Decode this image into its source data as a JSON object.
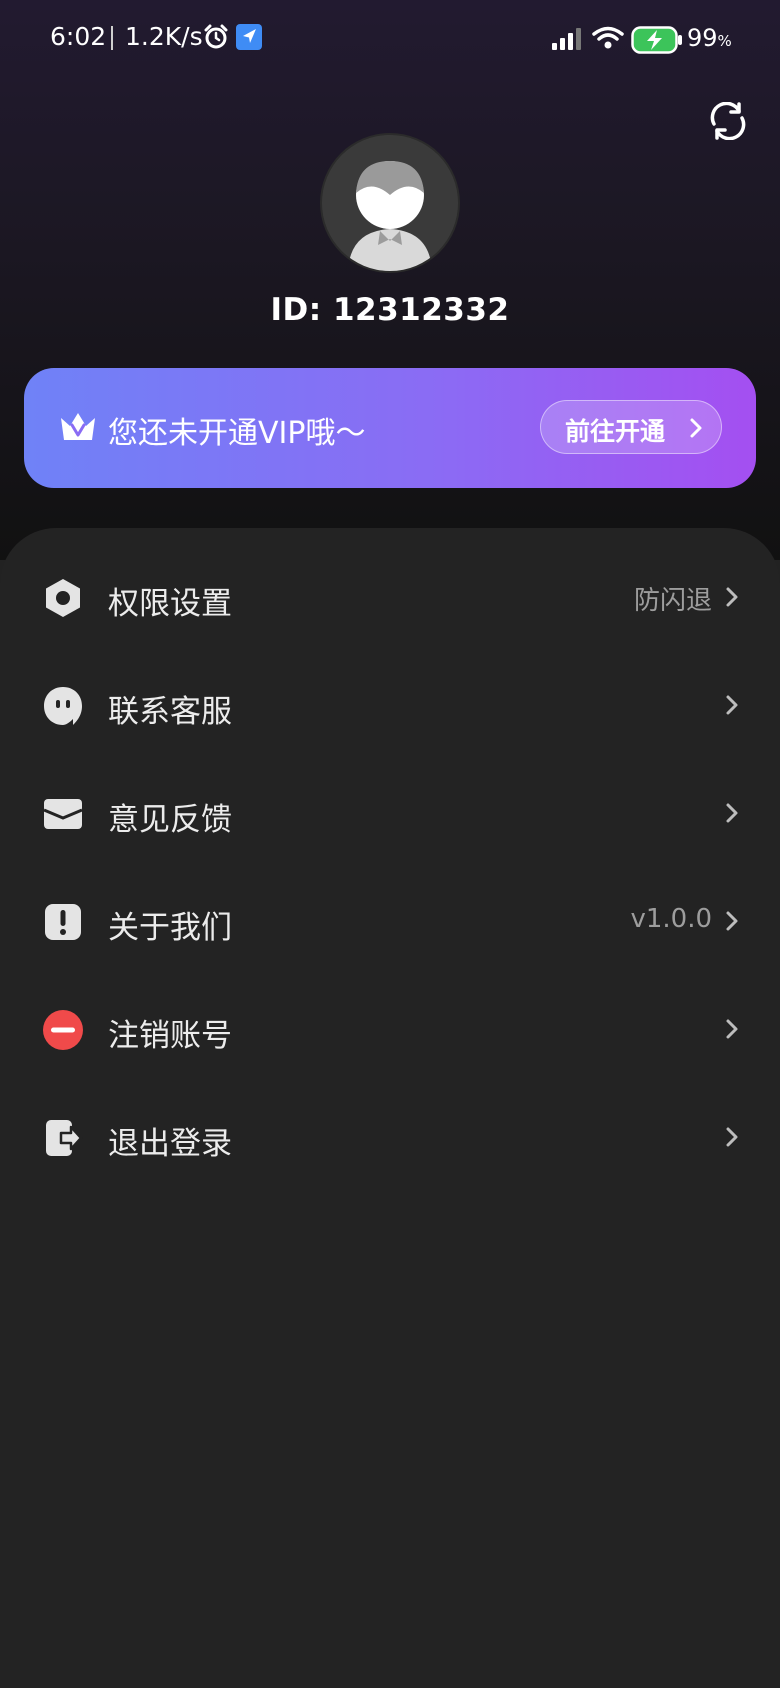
{
  "status_bar": {
    "time": "6:02",
    "net_speed": "1.2K/s",
    "battery_level": "99",
    "battery_unit": "%"
  },
  "profile": {
    "id_text": "ID: 12312332"
  },
  "vip": {
    "message": "您还未开通VIP哦～",
    "cta_label": "前往开通",
    "gradient_start": "#6f82f7",
    "gradient_end": "#a44ff1"
  },
  "menu": {
    "items": [
      {
        "label": "权限设置",
        "value": "防闪退",
        "icon": "hexagon-settings-icon"
      },
      {
        "label": "联系客服",
        "value": "",
        "icon": "chat-bubble-icon"
      },
      {
        "label": "意见反馈",
        "value": "",
        "icon": "envelope-icon"
      },
      {
        "label": "关于我们",
        "value": "v1.0.0",
        "icon": "info-exclamation-icon"
      },
      {
        "label": "注销账号",
        "value": "",
        "icon": "minus-circle-icon",
        "icon_color": "#f04a4a"
      },
      {
        "label": "退出登录",
        "value": "",
        "icon": "logout-icon"
      }
    ]
  }
}
